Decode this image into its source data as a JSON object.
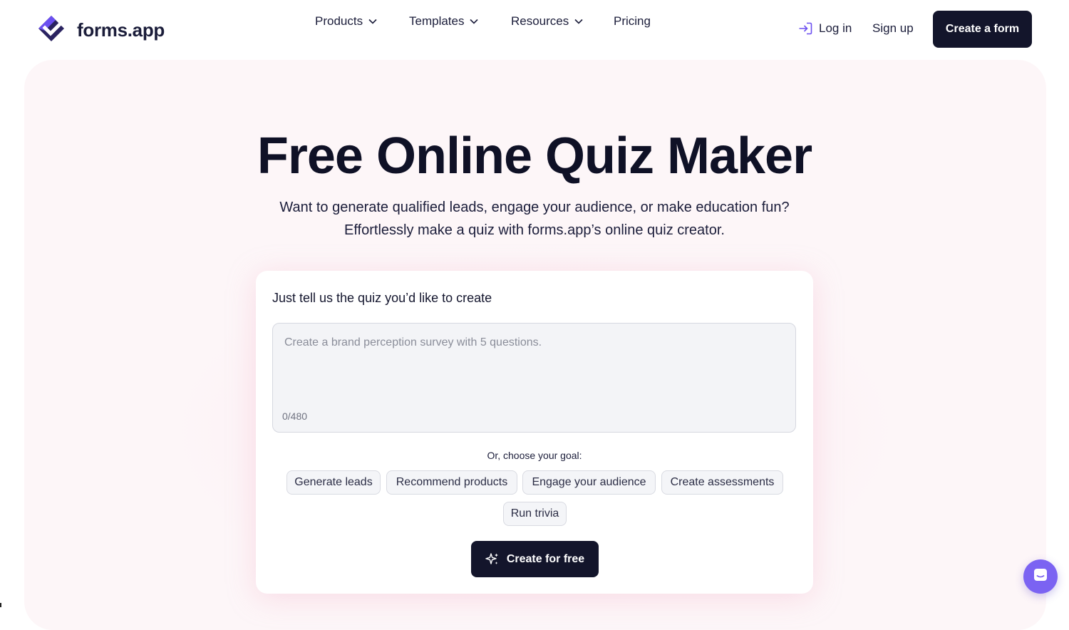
{
  "header": {
    "logo_text": "forms.app",
    "nav": [
      {
        "label": "Products"
      },
      {
        "label": "Templates"
      },
      {
        "label": "Resources"
      },
      {
        "label": "Pricing"
      }
    ],
    "login_label": "Log in",
    "signup_label": "Sign up",
    "cta_label": "Create a form"
  },
  "hero": {
    "title": "Free Online Quiz Maker",
    "subtitle_line1": "Want to generate qualified leads, engage your audience, or make education fun?",
    "subtitle_line2": "Effortlessly make a quiz with forms.app’s online quiz creator."
  },
  "card": {
    "label": "Just tell us the quiz you’d like to create",
    "input_placeholder": "Create a brand perception survey with 5 questions.",
    "input_value": "",
    "char_count": "0/480",
    "goal_title": "Or, choose your goal:",
    "goals": [
      "Generate leads",
      "Recommend products",
      "Engage your audience",
      "Create assessments",
      "Run trivia"
    ],
    "cta_label": "Create for free"
  },
  "icons": {
    "logo": "forms-app-logo-icon",
    "chevron": "chevron-down-icon",
    "login": "login-icon",
    "sparkle": "sparkle-icon",
    "chat": "chat-icon"
  },
  "colors": {
    "primary_dark": "#13152b",
    "logo_purple": "#6b4ff0",
    "hero_bg": "#fdf1f5",
    "chat_bubble": "#7b63f2"
  }
}
